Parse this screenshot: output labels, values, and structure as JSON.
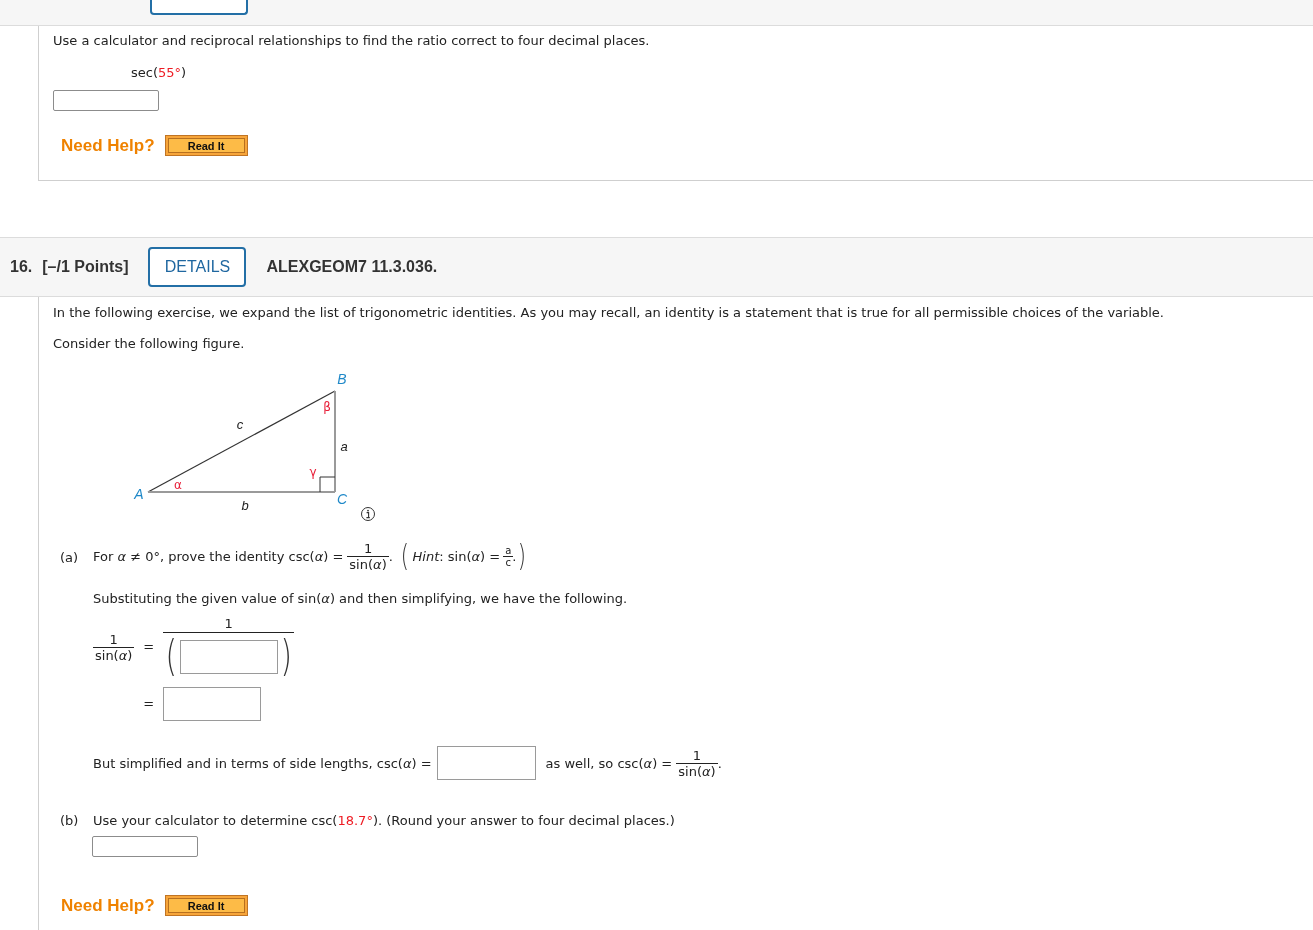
{
  "previous_question": {
    "instruction": "Use a calculator and reciprocal relationships to find the ratio correct to four decimal places.",
    "expression": {
      "before": "sec(",
      "value": "55°",
      "after": ")"
    },
    "help": {
      "label": "Need Help?",
      "button": "Read It"
    }
  },
  "question": {
    "number": "16.",
    "points": "[–/1 Points]",
    "details_button": "DETAILS",
    "code": "ALEXGEOM7 11.3.036.",
    "intro": "In the following exercise, we expand the list of trigonometric identities. As you may recall, an identity is a statement that is true for all permissible choices of the variable.",
    "figure_caption": "Consider the following figure.",
    "figure": {
      "vertices": [
        "A",
        "B",
        "C"
      ],
      "sides": [
        "a",
        "b",
        "c"
      ],
      "angles": [
        "α",
        "β",
        "γ"
      ]
    },
    "part_a": {
      "label": "(a)",
      "statement": "For *α* ≠ 0°, prove the identity csc(*α*) =",
      "statement_fraction": {
        "numerator": "1",
        "denominator": "sin(*α*)"
      },
      "statement_end": ".",
      "hint": {
        "open": "(",
        "text": "*Hint*: sin(*α*) =",
        "fraction": {
          "numerator": "a",
          "denominator": "c"
        },
        "end": ".",
        "close": ")"
      },
      "step": "Substituting the given value of sin(*α*) and then simplifying, we have the following.",
      "equation": {
        "lhs": {
          "numerator": "1",
          "denominator": "sin(*α*)"
        },
        "rows": [
          {
            "kind": "fraction",
            "equals": "=",
            "numerator": "1",
            "open": "(",
            "close": ")"
          },
          {
            "kind": "box",
            "equals": "="
          }
        ]
      },
      "conclusion": {
        "before": "But simplified and in terms of side lengths, csc(*α*) =",
        "after": "as well, so csc(*α*) =",
        "fraction": {
          "numerator": "1",
          "denominator": "sin(*α*)"
        },
        "end": "."
      }
    },
    "part_b": {
      "label": "(b)",
      "before": "Use your calculator to determine csc(",
      "value": "18.7°",
      "after": "). (Round your answer to four decimal places.)"
    },
    "help": {
      "label": "Need Help?",
      "button": "Read It"
    }
  }
}
